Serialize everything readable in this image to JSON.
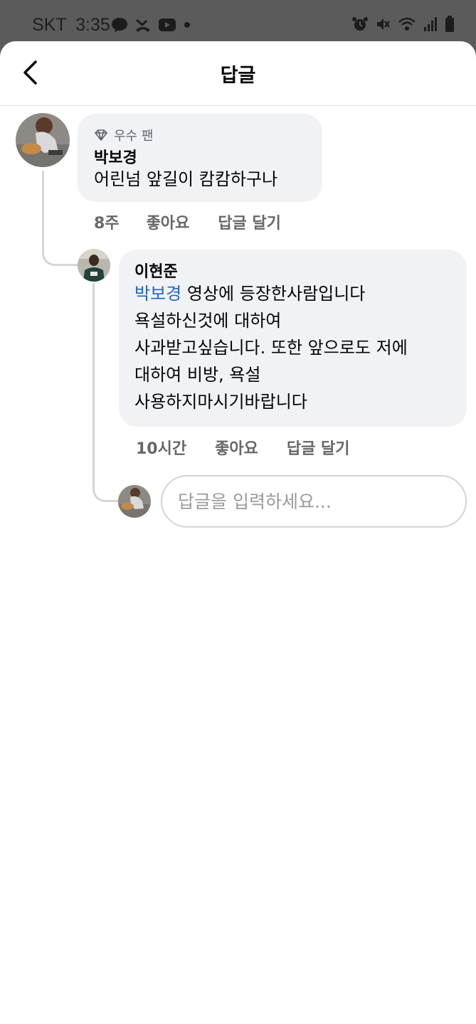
{
  "status_bar": {
    "carrier": "SKT",
    "time": "3:35"
  },
  "header": {
    "title": "답글"
  },
  "comments": [
    {
      "badge": "우수 팬",
      "author": "박보경",
      "text": "어린넘 앞길이 캄캄하구나",
      "time": "8주",
      "like_label": "좋아요",
      "reply_label": "답글 달기"
    },
    {
      "author": "이현준",
      "mention": "박보경",
      "lines": [
        " 영상에 등장한사람입니다",
        "욕설하신것에 대하여",
        "사과받고싶습니다. 또한 앞으로도 저에",
        "대하여 비방, 욕설",
        "사용하지마시기바랍니다"
      ],
      "time": "10시간",
      "like_label": "좋아요",
      "reply_label": "답글 달기"
    }
  ],
  "reply_box": {
    "placeholder": "답글을 입력하세요..."
  },
  "colors": {
    "status_bar_bg": "#5b5b5b",
    "bubble_bg": "#f0f2f5",
    "mention": "#2263c5",
    "meta_text": "#65676b"
  },
  "icons": {
    "back": "back-arrow-icon",
    "badge": "diamond-icon",
    "status": [
      "kakaotalk-icon",
      "missed-call-icon",
      "youtube-icon",
      "dot-icon",
      "alarm-icon",
      "mute-icon",
      "wifi-icon",
      "signal-icon",
      "battery-icon"
    ]
  }
}
